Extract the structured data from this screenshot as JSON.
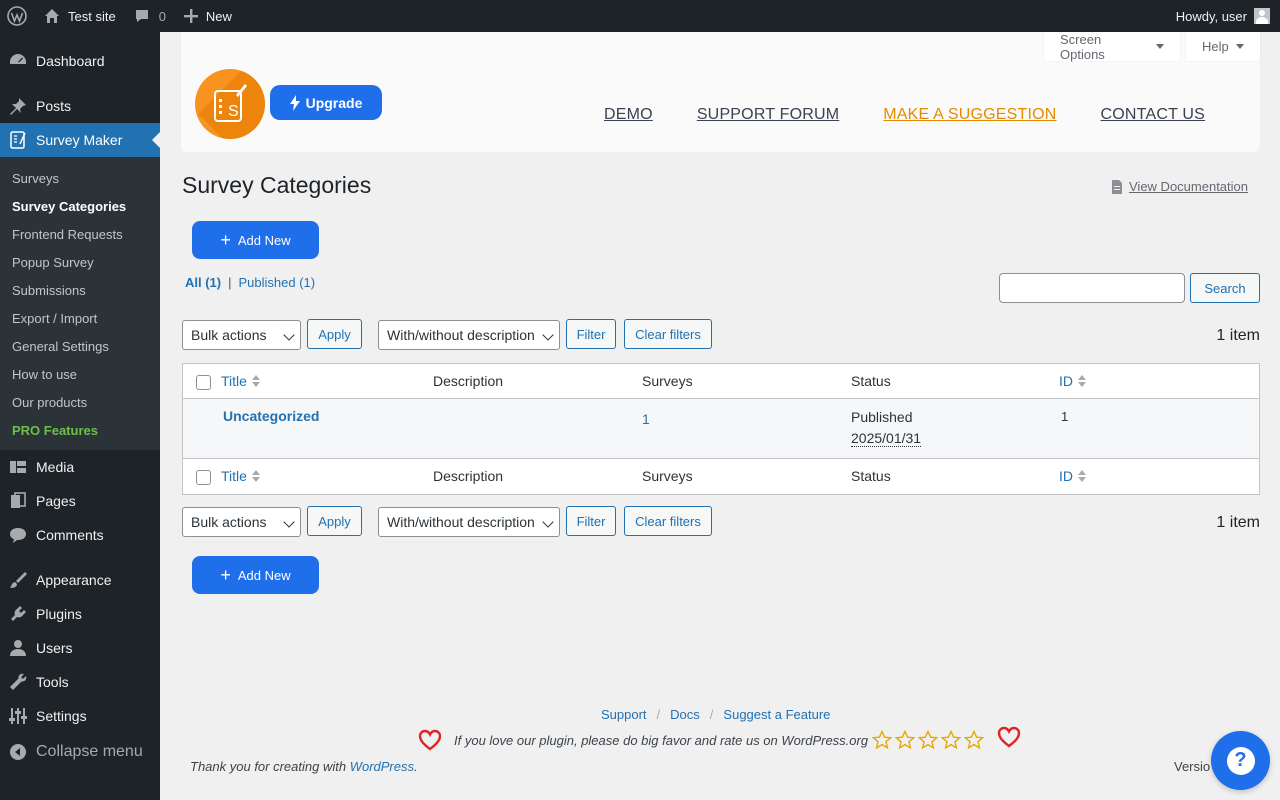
{
  "adminbar": {
    "site_name": "Test site",
    "comments_count": "0",
    "new_label": "New",
    "howdy": "Howdy, user"
  },
  "sidebar": {
    "items": [
      {
        "label": "Dashboard",
        "icon": "dashboard-icon"
      },
      {
        "label": "Posts",
        "icon": "pin-icon"
      },
      {
        "label": "Survey Maker",
        "icon": "survey-icon"
      },
      {
        "label": "Media",
        "icon": "media-icon"
      },
      {
        "label": "Pages",
        "icon": "pages-icon"
      },
      {
        "label": "Comments",
        "icon": "comment-icon"
      },
      {
        "label": "Appearance",
        "icon": "brush-icon"
      },
      {
        "label": "Plugins",
        "icon": "plug-icon"
      },
      {
        "label": "Users",
        "icon": "user-icon"
      },
      {
        "label": "Tools",
        "icon": "wrench-icon"
      },
      {
        "label": "Settings",
        "icon": "sliders-icon"
      },
      {
        "label": "Collapse menu",
        "icon": "collapse-icon"
      }
    ],
    "submenu": [
      "Surveys",
      "Survey Categories",
      "Frontend Requests",
      "Popup Survey",
      "Submissions",
      "Export / Import",
      "General Settings",
      "How to use",
      "Our products",
      "PRO Features"
    ]
  },
  "screen_options": "Screen Options",
  "help": "Help",
  "plugin_header": {
    "upgrade": "Upgrade",
    "links": [
      "DEMO",
      "SUPPORT FORUM",
      "MAKE A SUGGESTION",
      "CONTACT US"
    ]
  },
  "page": {
    "title": "Survey Categories",
    "view_doc": "View Documentation",
    "add_new": "Add New",
    "views": {
      "all": "All (1)",
      "sep": "|",
      "published": "Published (1)"
    },
    "search_button": "Search",
    "bulk_actions": "Bulk actions",
    "apply": "Apply",
    "desc_filter": "With/without description",
    "filter": "Filter",
    "clear_filters": "Clear filters",
    "item_count": "1 item"
  },
  "table": {
    "columns": [
      "Title",
      "Description",
      "Surveys",
      "Status",
      "ID"
    ],
    "rows": [
      {
        "title": "Uncategorized",
        "description": "",
        "surveys": "1",
        "status": "Published",
        "date": "2025/01/31",
        "id": "1"
      }
    ]
  },
  "footer": {
    "links": [
      "Support",
      "Docs",
      "Suggest a Feature"
    ],
    "sep": "/",
    "rate_text": "If you love our plugin, please do big favor and rate us on WordPress.org",
    "thanks_prefix": "Thank you for creating with",
    "thanks_link": "WordPress",
    "thanks_suffix": ".",
    "version": "Versio",
    "help_bubble": "?"
  },
  "colors": {
    "accent": "#2271b1",
    "button_blue": "#1f6feb",
    "orange": "#f7931e",
    "heart": "#e02424",
    "star": "#e6a800",
    "pro": "#6cc04a"
  }
}
